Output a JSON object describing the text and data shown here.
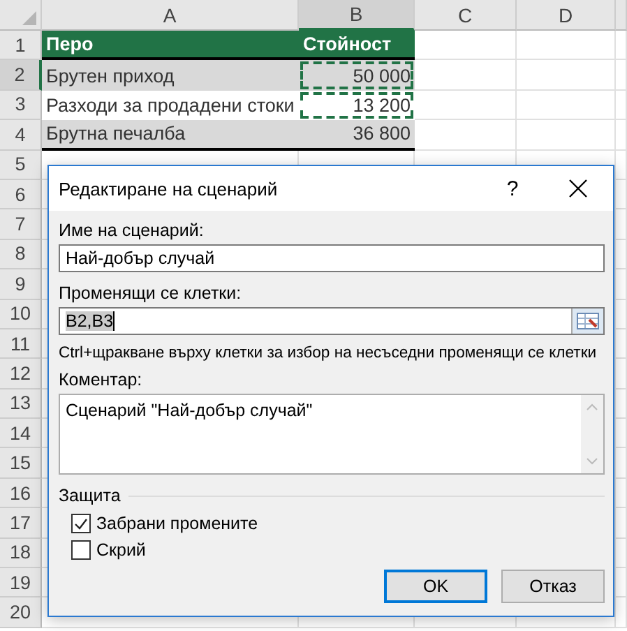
{
  "column_headers": [
    {
      "label": "A",
      "selected": false
    },
    {
      "label": "B",
      "selected": true
    },
    {
      "label": "C",
      "selected": false
    },
    {
      "label": "D",
      "selected": false
    }
  ],
  "rows": [
    {
      "number": "1",
      "selected": false,
      "kind": "header",
      "marquee": false,
      "cells": [
        "Перо",
        "Стойност"
      ]
    },
    {
      "number": "2",
      "selected": true,
      "kind": "shaded",
      "marquee": true,
      "cells": [
        "Брутен приход",
        "50 000"
      ]
    },
    {
      "number": "3",
      "selected": false,
      "kind": "plain",
      "marquee": true,
      "cells": [
        "Разходи за продадени стоки",
        "13 200"
      ]
    },
    {
      "number": "4",
      "selected": false,
      "kind": "total",
      "marquee": false,
      "cells": [
        "Брутна печалба",
        "36 800"
      ]
    }
  ],
  "empty_rows": [
    "5",
    "6",
    "7",
    "8",
    "9",
    "10",
    "11",
    "12",
    "13",
    "14",
    "15",
    "16",
    "17",
    "18",
    "19",
    "20"
  ],
  "dialog": {
    "title": "Редактиране на сценарий",
    "help": "?",
    "name_label": "Име на сценарий:",
    "name_value": "Най-добър случай",
    "cells_label": "Променящи се клетки:",
    "cells_value": "B2,B3",
    "hint": "Ctrl+щракване върху клетки за избор на несъседни променящи се клетки",
    "comment_label": "Коментар:",
    "comment_value": "Сценарий \"Най-добър случай\"",
    "protection_title": "Защита",
    "checkboxes": [
      {
        "label": "Забрани промените",
        "checked": true
      },
      {
        "label": "Скрий",
        "checked": false
      }
    ],
    "buttons": [
      {
        "label": "OK",
        "default": true
      },
      {
        "label": "Отказ",
        "default": false
      }
    ]
  }
}
